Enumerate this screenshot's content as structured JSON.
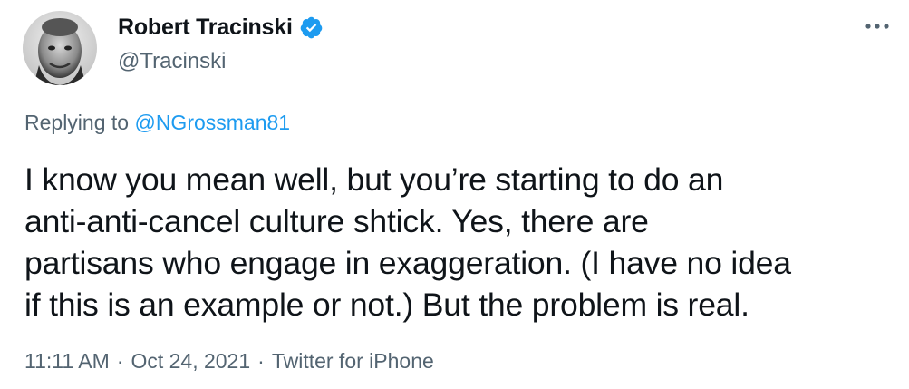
{
  "author": {
    "display_name": "Robert Tracinski",
    "handle": "@Tracinski",
    "verified": true,
    "avatar_icon": "user-avatar-photo"
  },
  "reply": {
    "prefix": "Replying to ",
    "mention": "@NGrossman81"
  },
  "tweet": {
    "lines": [
      "I know you mean well, but you’re starting to do an",
      "anti-anti-cancel culture shtick. Yes, there are",
      "partisans who engage in exaggeration. (I have no idea",
      "if this is an example or not.) But the problem is real."
    ]
  },
  "meta": {
    "time": "11:11 AM",
    "separator": "·",
    "date": "Oct 24, 2021",
    "source": "Twitter for iPhone"
  },
  "icons": {
    "verified": "verified-badge-icon",
    "more": "more-options-icon"
  },
  "colors": {
    "text_primary": "#0f1419",
    "text_secondary": "#536471",
    "accent": "#1d9bf0"
  }
}
